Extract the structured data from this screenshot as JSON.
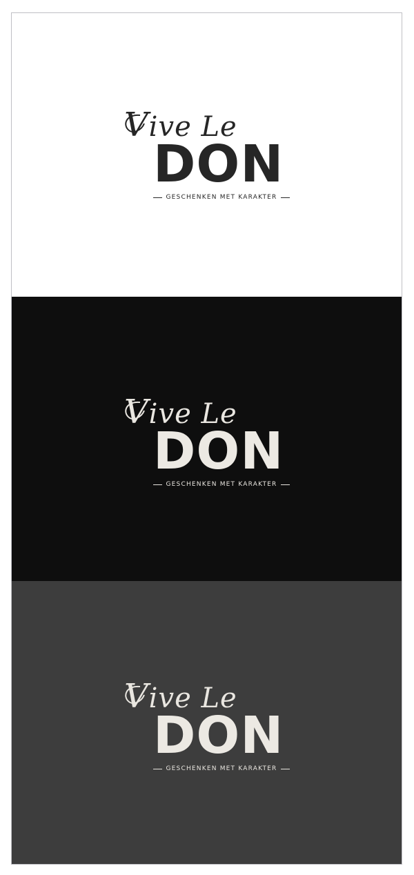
{
  "logo": {
    "script_text": "Vive Le",
    "script_first": "V",
    "script_rest": "ive Le",
    "wordmark": "DON",
    "tagline": "GESCHENKEN MET KARAKTER"
  },
  "variants": [
    {
      "background": "#ffffff",
      "script_color": "#262626",
      "wordmark_color": "#262626",
      "tagline_color": "#262626"
    },
    {
      "background": "#0e0e0e",
      "script_color": "#e9e6e0",
      "wordmark_color": "#ece9e3",
      "tagline_color": "#e9e6e0"
    },
    {
      "background": "#3d3d3d",
      "script_color": "#e9e6e0",
      "wordmark_color": "#ece9e3",
      "tagline_color": "#e9e6e0"
    }
  ]
}
